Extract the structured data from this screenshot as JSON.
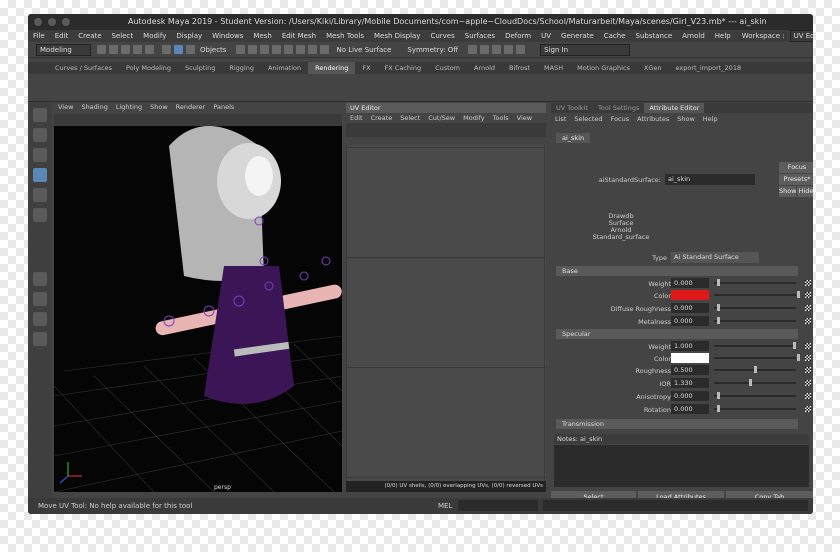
{
  "window": {
    "title": "Autodesk Maya 2019 - Student Version: /Users/Kiki/Library/Mobile Documents/com~apple~CloudDocs/School/Maturarbeit/Maya/scenes/Girl_V23.mb*  ---  ai_skin"
  },
  "menubar": [
    "File",
    "Edit",
    "Create",
    "Select",
    "Modify",
    "Display",
    "Windows",
    "Mesh",
    "Edit Mesh",
    "Mesh Tools",
    "Mesh Display",
    "Curves",
    "Surfaces",
    "Deform",
    "UV",
    "Generate",
    "Cache",
    "Substance",
    "Arnold",
    "Help"
  ],
  "workspace": {
    "label": "Workspace :",
    "value": "UV Editing*"
  },
  "toolbar": {
    "mode": "Modeling",
    "objects": "Objects",
    "live": "No Live Surface",
    "symmetry": "Symmetry: Off",
    "signin": "Sign In"
  },
  "shelf": {
    "tabs": [
      "Curves / Surfaces",
      "Poly Modeling",
      "Sculpting",
      "Rigging",
      "Animation",
      "Rendering",
      "FX",
      "FX Caching",
      "Custom",
      "Arnold",
      "Bifrost",
      "MASH",
      "Motion Graphics",
      "XGen",
      "export_import_2018"
    ],
    "active": "Rendering"
  },
  "viewport": {
    "menu": [
      "View",
      "Shading",
      "Lighting",
      "Show",
      "Renderer",
      "Panels"
    ],
    "camera": "persp"
  },
  "uv_editor": {
    "title": "UV Editor",
    "menu": [
      "Edit",
      "Create",
      "Select",
      "Cut/Sew",
      "Modify",
      "Tools",
      "View"
    ],
    "status": "(0/0) UV shells, (0/0) overlapping UVs, (0/0) reversed UVs"
  },
  "attribute_editor": {
    "tabs": [
      "UV Toolkit",
      "Tool Settings",
      "Attribute Editor"
    ],
    "active_tab": "Attribute Editor",
    "menu": [
      "List",
      "Selected",
      "Focus",
      "Attributes",
      "Show",
      "Help"
    ],
    "node_tab": "ai_skin",
    "node_label": "aiStandardSurface:",
    "node_value": "ai_skin",
    "focus": "Focus",
    "presets": "Presets*",
    "show": "Show",
    "hide": "Hide",
    "classification": [
      "Drawdb",
      "Surface",
      "Arnold",
      "Standard_surface"
    ],
    "type_label": "Type",
    "type_value": "Ai Standard Surface",
    "base": {
      "title": "Base",
      "weight_label": "Weight",
      "weight": "0.000",
      "color_label": "Color",
      "color": "#e01818",
      "diff_label": "Diffuse Roughness",
      "diff": "0.000",
      "metal_label": "Metalness",
      "metal": "0.000"
    },
    "specular": {
      "title": "Specular",
      "weight_label": "Weight",
      "weight": "1.000",
      "color_label": "Color",
      "color": "#ffffff",
      "rough_label": "Roughness",
      "rough": "0.500",
      "ior_label": "IOR",
      "ior": "1.330",
      "aniso_label": "Anisotropy",
      "aniso": "0.000",
      "rot_label": "Rotation",
      "rot": "0.000"
    },
    "transmission": "Transmission",
    "notes": "Notes:  ai_skin",
    "buttons": {
      "select": "Select",
      "load": "Load Attributes",
      "copy": "Copy Tab"
    }
  },
  "helpline": {
    "text": "Move UV Tool: No help available for this tool",
    "mel": "MEL"
  }
}
